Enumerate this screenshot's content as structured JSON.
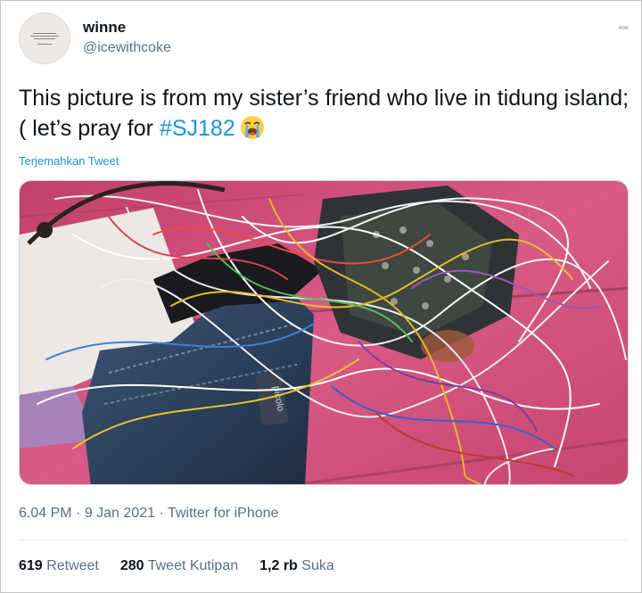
{
  "user": {
    "display_name": "winne",
    "handle": "@icewithcoke"
  },
  "tweet": {
    "text_before": "This picture is from my sister’s friend who live in tidung island;( let’s pray for ",
    "hashtag": "#SJ182",
    "emoji": "loudly-crying-face-icon",
    "translate_label": "Terjemahkan Tweet"
  },
  "media": {
    "description_icon": "photo"
  },
  "meta": {
    "time": "6.04 PM",
    "separator1": " · ",
    "date": "9 Jan 2021",
    "separator2": " · ",
    "source": "Twitter for iPhone"
  },
  "stats": {
    "retweets_count": "619",
    "retweets_label": "Retweet",
    "quotes_count": "280",
    "quotes_label": "Tweet Kutipan",
    "likes_count": "1,2 rb",
    "likes_label": "Suka"
  },
  "colors": {
    "link": "#1b95e0",
    "secondary_text": "#5b7083",
    "primary_text": "#0f1419"
  }
}
